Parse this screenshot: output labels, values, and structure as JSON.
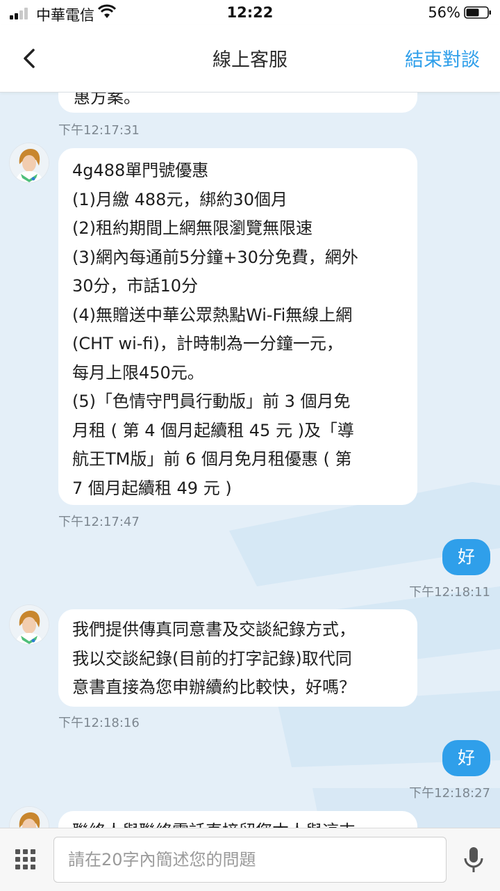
{
  "status_bar": {
    "carrier": "中華電信",
    "time": "12:22",
    "battery": "56%",
    "icons": [
      "signal-icon",
      "wifi-icon",
      "battery-icon"
    ]
  },
  "header": {
    "back_icon": "chevron-left-icon",
    "title": "線上客服",
    "end_label": "結束對談"
  },
  "messages": [
    {
      "from": "agent",
      "lines": [
        "惠方案。"
      ],
      "time": "下午12:17:31"
    },
    {
      "from": "agent",
      "lines": [
        "4g488單門號優惠",
        "(1)月繳 488元，綁約30個月",
        "(2)租約期間上網無限瀏覽無限速",
        "(3)網內每通前5分鐘+30分免費，網外",
        "30分，市話10分",
        "(4)無贈送中華公眾熱點Wi-Fi無線上網",
        "(CHT wi-fi)，計時制為一分鐘一元，",
        "每月上限450元。",
        "(5)「色情守門員行動版」前 3 個月免",
        "月租 ( 第 4 個月起續租 45 元 )及「導",
        "航王TM版」前 6 個月免月租優惠 ( 第",
        "7 個月起續租 49 元 )"
      ],
      "time": "下午12:17:47"
    },
    {
      "from": "user",
      "text": "好",
      "time": "下午12:18:11"
    },
    {
      "from": "agent",
      "lines": [
        "我們提供傳真同意書及交談紀錄方式，",
        "我以交談紀錄(目前的打字記錄)取代同",
        "意書直接為您申辦續約比較快，好嗎？"
      ],
      "time": "下午12:18:16"
    },
    {
      "from": "user",
      "text": "好",
      "time": "下午12:18:27"
    },
    {
      "from": "agent",
      "lines": [
        "聯絡人與聯絡電話直接留您本人與這支"
      ]
    }
  ],
  "input": {
    "placeholder": "請在20字內簡述您的問題",
    "value": "",
    "menu_icon": "grid-menu-icon",
    "mic_icon": "microphone-icon"
  },
  "colors": {
    "accent": "#2f9fea",
    "chat_bg": "#e4eff8",
    "bubble": "#ffffff",
    "timestamp": "#7d8790"
  }
}
